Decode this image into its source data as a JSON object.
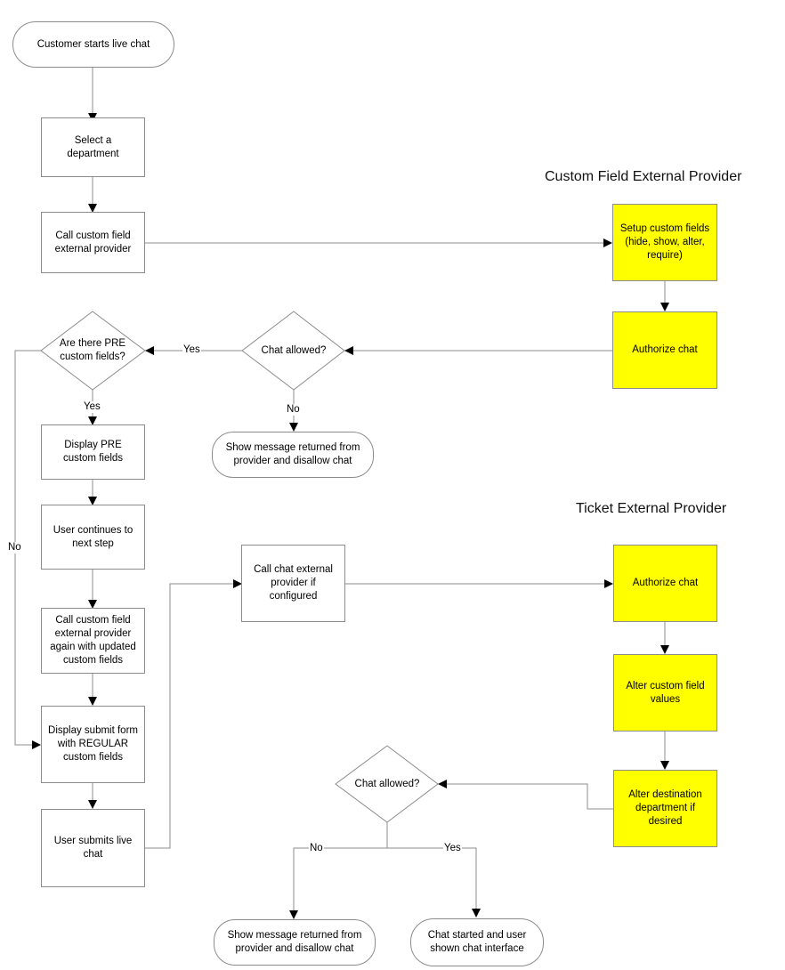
{
  "lanes": {
    "custom_field": "Custom Field External Provider",
    "ticket": "Ticket External Provider"
  },
  "nodes": {
    "start": "Customer starts live chat",
    "select_department": "Select a department",
    "call_custom_field": "Call custom field external provider",
    "pre_fields_decision": "Are there PRE custom fields?",
    "display_pre": "Display PRE custom fields",
    "user_continues": "User continues to next step",
    "call_custom_field_again": "Call custom field external provider again with updated custom fields",
    "display_submit": "Display submit form with REGULAR custom fields",
    "user_submits": "User submits live chat",
    "call_chat_provider": "Call chat external provider if configured",
    "cf_setup": "Setup custom fields (hide, show, alter, require)",
    "cf_authorize": "Authorize chat",
    "chat_allowed_1": "Chat allowed?",
    "disallow_1": "Show message returned from provider and disallow chat",
    "tk_authorize": "Authorize chat",
    "tk_alter_fields": "Alter custom field values",
    "tk_alter_dept": "Alter destination department if desired",
    "chat_allowed_2": "Chat allowed?",
    "disallow_2": "Show message returned from provider and disallow chat",
    "chat_started": "Chat started and user shown chat interface"
  },
  "edge_labels": {
    "yes_1": "Yes",
    "no_1": "No",
    "pre_yes": "Yes",
    "pre_no": "No",
    "no_2": "No",
    "yes_2": "Yes"
  },
  "colors": {
    "provider_fill": "#ffff00",
    "stroke": "#8c8c8c"
  }
}
